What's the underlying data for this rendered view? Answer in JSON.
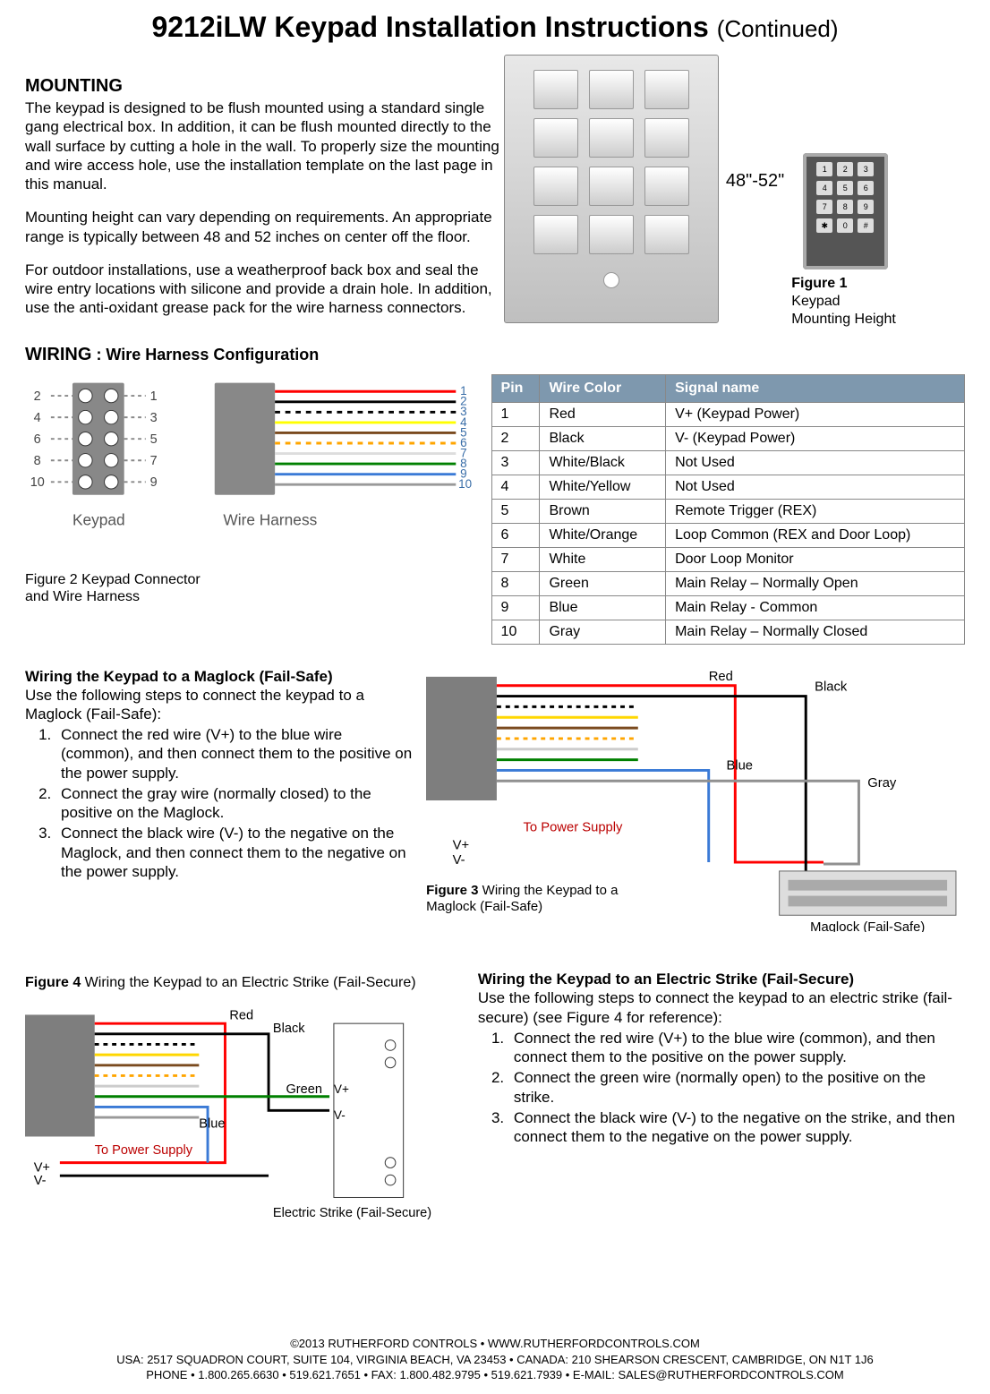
{
  "title_main": "9212iLW Keypad Installation Instructions",
  "title_cont": "(Continued)",
  "mounting": {
    "heading": "MOUNTING",
    "p1": "The keypad is designed to be flush mounted using a standard single gang electrical box. In addition, it can be flush mounted directly to the wall surface by cutting a hole in the wall. To properly size the mounting and wire access hole, use the installation template on the last page in this manual.",
    "p2": "Mounting height can vary depending on requirements. An appropriate range is typically between 48 and 52 inches on center off the floor.",
    "p3": "For outdoor installations, use a weatherproof back box and seal the wire entry locations with silicone and provide a drain hole. In addition, use the anti-oxidant grease pack for the wire harness connectors."
  },
  "height_label": "48\"-52\"",
  "fig1_caption_bold": "Figure 1",
  "fig1_caption_rest": " Keypad Mounting Height",
  "wiring_heading": "WIRING",
  "wiring_sub": " : Wire Harness Configuration",
  "connector_label_keypad": "Keypad",
  "connector_label_harness": "Wire Harness",
  "fig2_caption": "Figure 2 Keypad Connector and Wire Harness",
  "pinout": {
    "headers": {
      "pin": "Pin",
      "color": "Wire Color",
      "signal": "Signal name"
    },
    "rows": [
      {
        "pin": "1",
        "color": "Red",
        "signal": "V+ (Keypad Power)"
      },
      {
        "pin": "2",
        "color": "Black",
        "signal": "V- (Keypad Power)"
      },
      {
        "pin": "3",
        "color": "White/Black",
        "signal": "Not Used"
      },
      {
        "pin": "4",
        "color": "White/Yellow",
        "signal": "Not Used"
      },
      {
        "pin": "5",
        "color": "Brown",
        "signal": "Remote Trigger (REX)"
      },
      {
        "pin": "6",
        "color": "White/Orange",
        "signal": "Loop Common (REX and Door Loop)"
      },
      {
        "pin": "7",
        "color": "White",
        "signal": "Door Loop Monitor"
      },
      {
        "pin": "8",
        "color": "Green",
        "signal": "Main Relay – Normally Open"
      },
      {
        "pin": "9",
        "color": "Blue",
        "signal": "Main Relay - Common"
      },
      {
        "pin": "10",
        "color": "Gray",
        "signal": "Main Relay – Normally Closed"
      }
    ]
  },
  "maglock": {
    "heading": "Wiring the Keypad to a Maglock (Fail-Safe)",
    "intro": "Use the following steps to connect the keypad to a Maglock (Fail-Safe):",
    "steps": [
      "Connect the red wire (V+) to the blue wire (common), and then connect them to the positive  on the power supply.",
      "Connect the gray wire (normally closed) to the positive on the Maglock.",
      "Connect the black wire (V-) to the negative on the Maglock, and then connect them to the negative on the power supply."
    ]
  },
  "fig3": {
    "labels": {
      "red": "Red",
      "black": "Black",
      "blue": "Blue",
      "gray": "Gray",
      "tops": "To Power Supply",
      "vp": "V+",
      "vm": "V-",
      "maglock": "Maglock (Fail-Safe)"
    },
    "caption_b": "Figure 3",
    "caption_r": " Wiring the Keypad to a Maglock (Fail-Safe)"
  },
  "fig4": {
    "caption_b": "Figure 4",
    "caption_r": " Wiring the Keypad to an Electric Strike (Fail-Secure)",
    "labels": {
      "red": "Red",
      "black": "Black",
      "green": "Green",
      "blue": "Blue",
      "tops": "To Power Supply",
      "vp": "V+",
      "vm": "V-",
      "strike": "Electric Strike (Fail-Secure)"
    }
  },
  "strike": {
    "heading": "Wiring the Keypad to an Electric Strike (Fail-Secure)",
    "intro": "Use the following steps to connect the keypad to an electric strike (fail-secure) (see Figure 4 for reference):",
    "steps": [
      "Connect the red wire (V+) to the blue wire (common), and then connect them to the positive on the power supply.",
      "Connect the green wire (normally open) to the positive on the strike.",
      "Connect the black wire (V-) to the negative on the strike, and then connect them to the negative on the power supply."
    ]
  },
  "footer": {
    "l1": "©2013 RUTHERFORD CONTROLS • WWW.RUTHERFORDCONTROLS.COM",
    "l2": "USA: 2517 SQUADRON COURT, SUITE 104, VIRGINIA BEACH, VA 23453 • CANADA: 210 SHEARSON CRESCENT, CAMBRIDGE, ON  N1T 1J6",
    "l3": "PHONE • 1.800.265.6630 • 519.621.7651 • FAX: 1.800.482.9795 • 519.621.7939 • E-MAIL: SALES@RUTHERFORDCONTROLS.COM"
  }
}
